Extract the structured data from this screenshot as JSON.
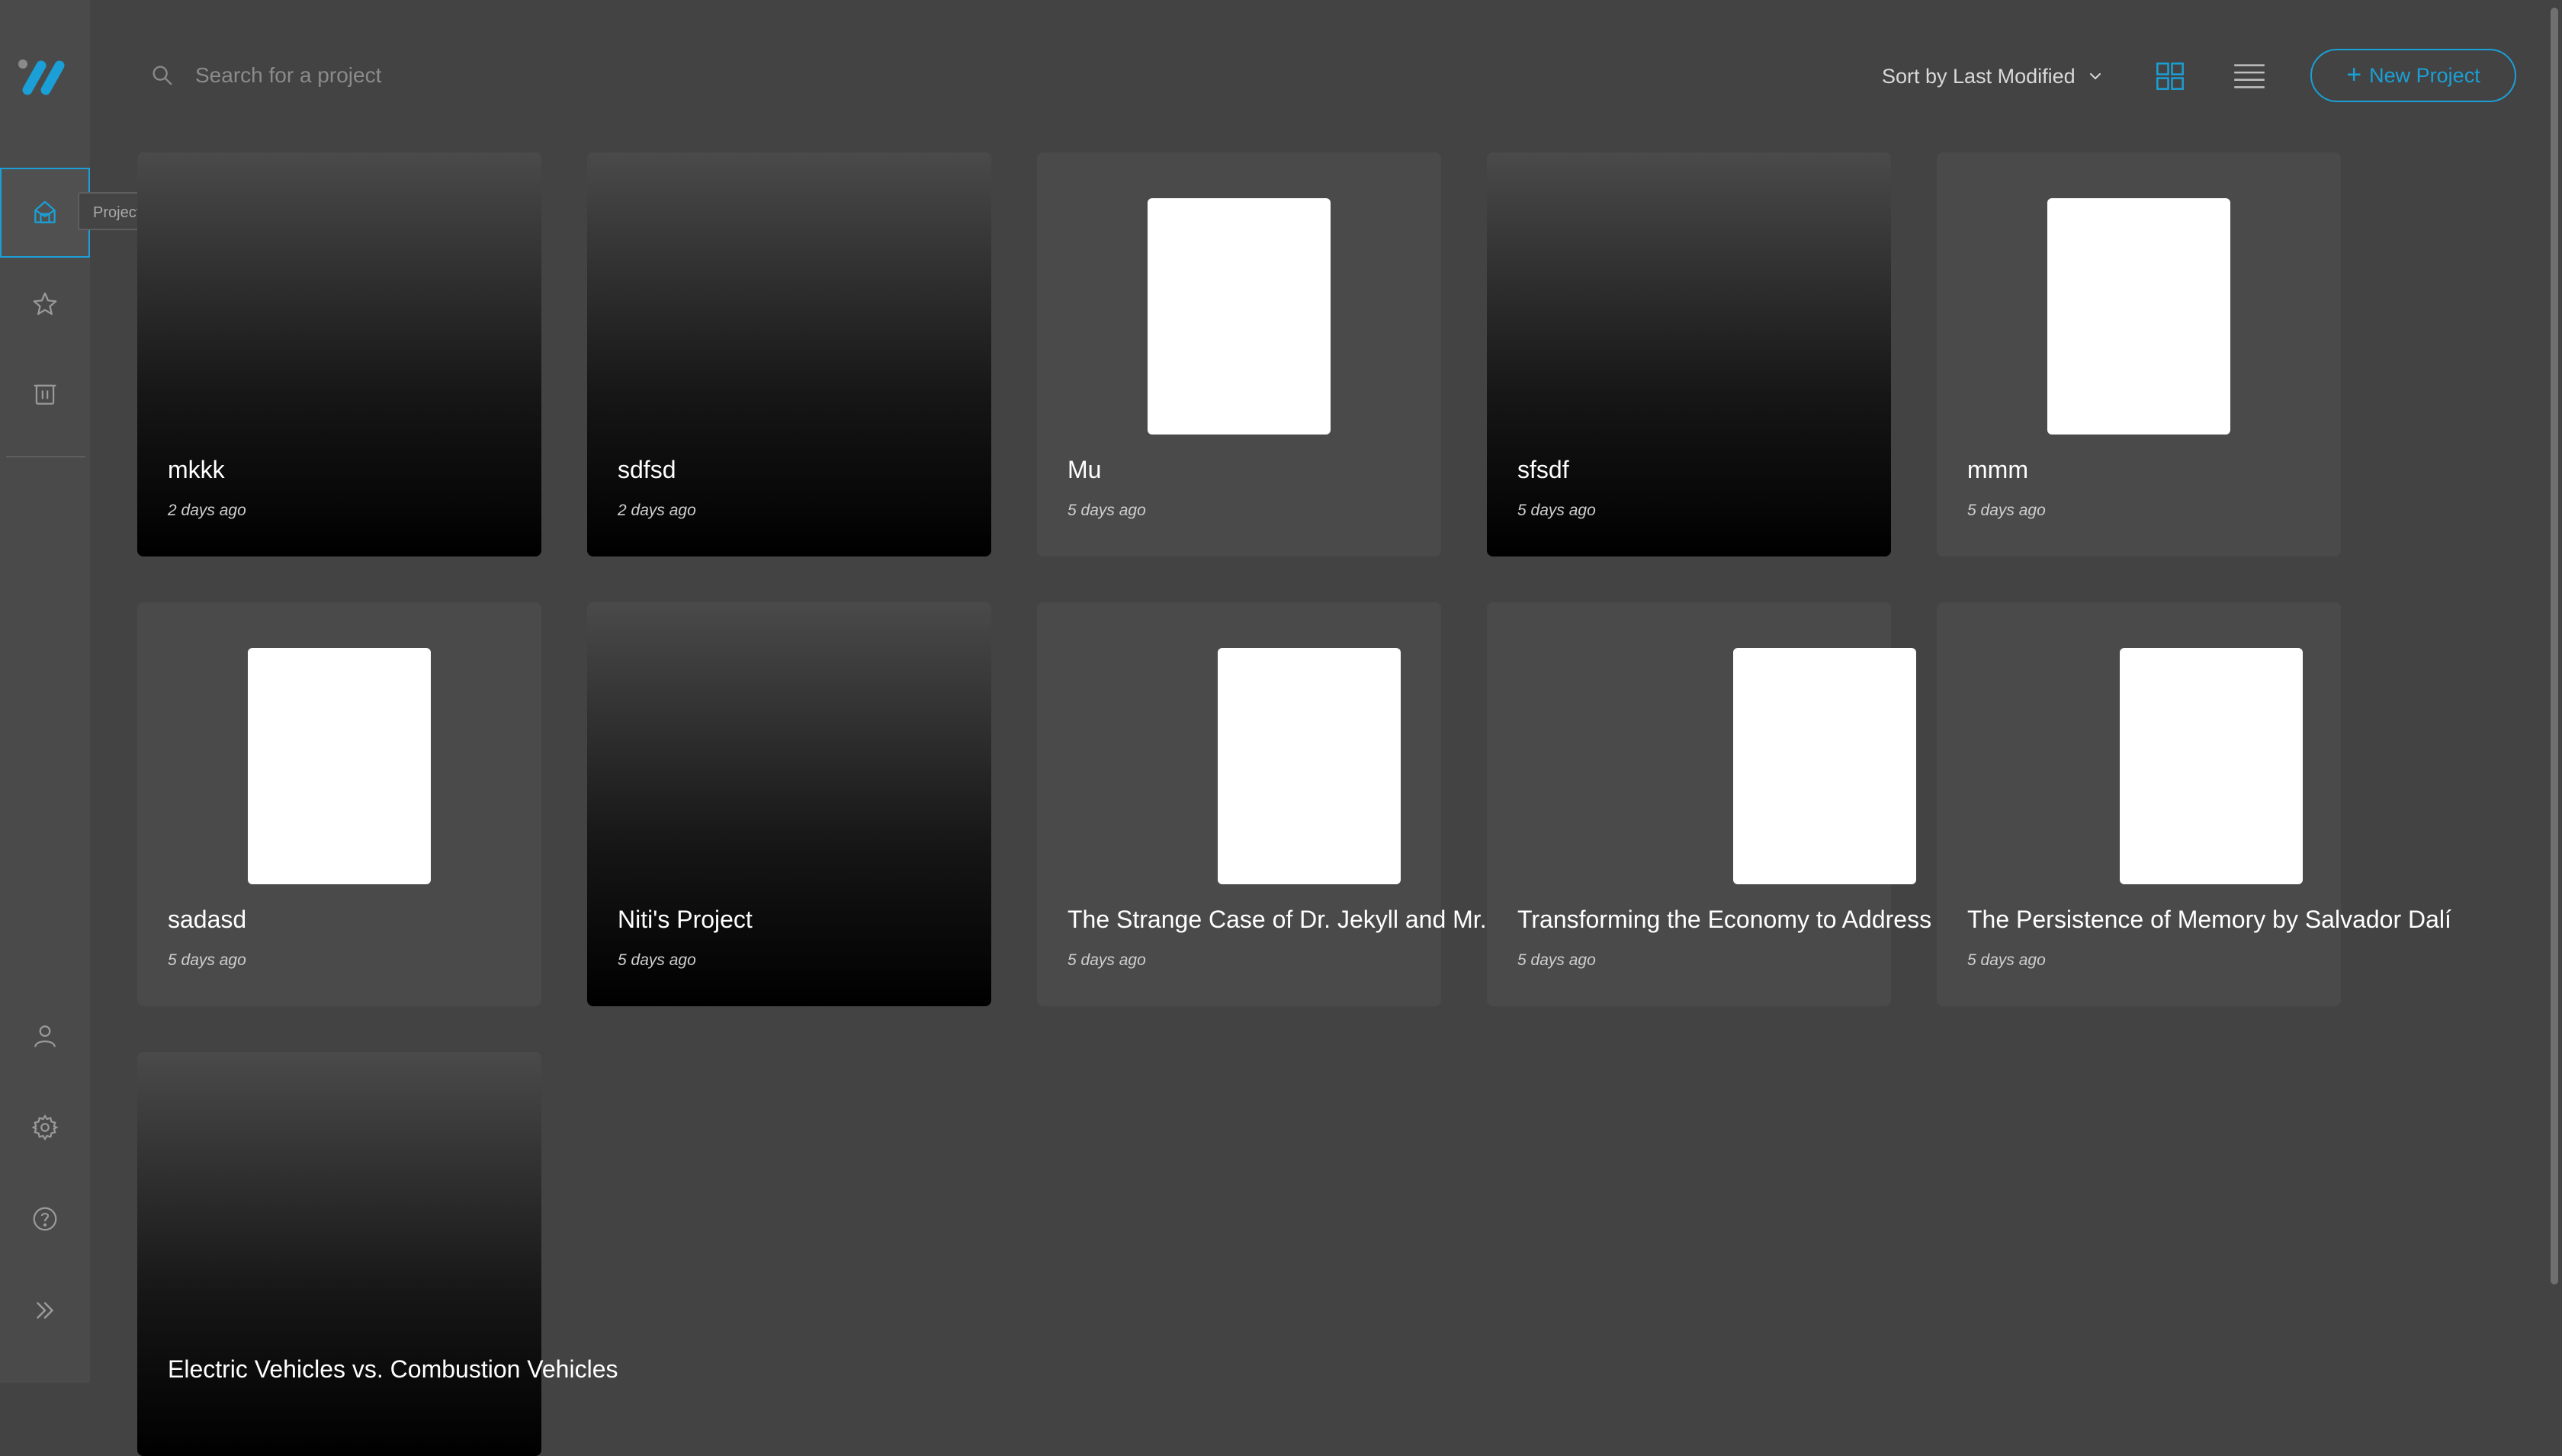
{
  "colors": {
    "accent": "#1aa0d6",
    "background": "#434343",
    "sidebar": "#4a4a4a"
  },
  "sidebar": {
    "tooltip": "Projects",
    "items": [
      {
        "icon": "projects-icon",
        "active": true
      },
      {
        "icon": "star-icon"
      },
      {
        "icon": "trash-icon"
      },
      {
        "icon": "user-icon"
      },
      {
        "icon": "gear-icon"
      },
      {
        "icon": "help-icon"
      },
      {
        "icon": "expand-icon"
      }
    ]
  },
  "header": {
    "search_placeholder": "Search for a project",
    "sort_label": "Sort by Last Modified",
    "new_project_label": "New Project"
  },
  "projects": [
    {
      "title": "mkkk",
      "date": "2 days ago",
      "thumbnail": false
    },
    {
      "title": "sdfsd",
      "date": "2 days ago",
      "thumbnail": false
    },
    {
      "title": "Mu",
      "date": "5 days ago",
      "thumbnail": true
    },
    {
      "title": "sfsdf",
      "date": "5 days ago",
      "thumbnail": false
    },
    {
      "title": "mmm",
      "date": "5 days ago",
      "thumbnail": true
    },
    {
      "title": "sadasd",
      "date": "5 days ago",
      "thumbnail": true
    },
    {
      "title": "Niti's Project",
      "date": "5 days ago",
      "thumbnail": false
    },
    {
      "title": "The Strange Case of Dr. Jekyll and Mr.",
      "date": "5 days ago",
      "thumbnail": true
    },
    {
      "title": "Transforming the Economy to Address",
      "date": "5 days ago",
      "thumbnail": true
    },
    {
      "title": "The Persistence of Memory by Salvador Dalí",
      "date": "5 days ago",
      "thumbnail": true
    },
    {
      "title": "Electric Vehicles vs. Combustion Vehicles",
      "date": "",
      "thumbnail": false
    }
  ]
}
